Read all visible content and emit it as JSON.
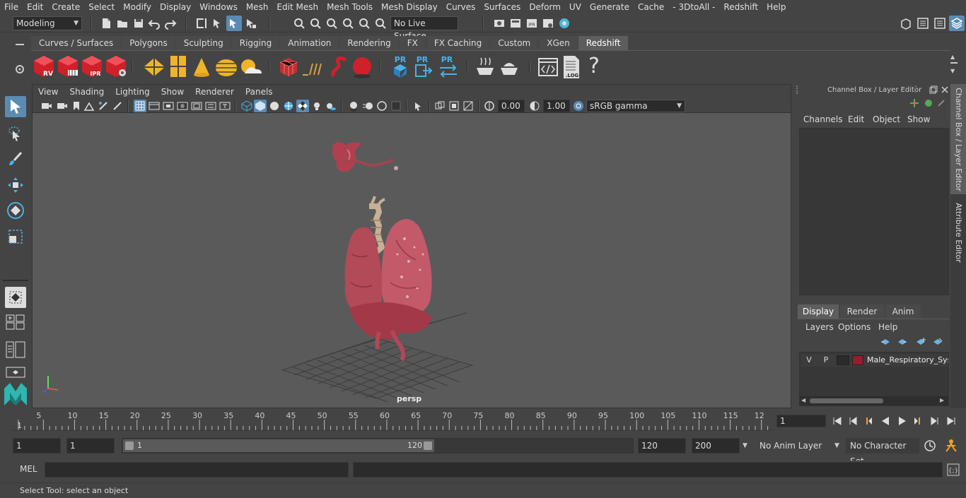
{
  "menubar": {
    "items": [
      "File",
      "Edit",
      "Create",
      "Select",
      "Modify",
      "Display",
      "Windows",
      "Mesh",
      "Edit Mesh",
      "Mesh Tools",
      "Mesh Display",
      "Curves",
      "Surfaces",
      "Deform",
      "UV",
      "Generate",
      "Cache",
      "- 3DtoAll -",
      "Redshift",
      "Help"
    ]
  },
  "statusline": {
    "mode": "Modeling",
    "live_surface": "No Live Surface"
  },
  "shelf": {
    "tabs": [
      "Curves / Surfaces",
      "Polygons",
      "Sculpting",
      "Rigging",
      "Animation",
      "Rendering",
      "FX",
      "FX Caching",
      "Custom",
      "XGen",
      "Redshift"
    ],
    "active_tab": "Redshift",
    "icon_labels": [
      "RV",
      "IPR",
      "PR",
      "PR",
      "PR",
      ".LOG",
      "?"
    ]
  },
  "viewport": {
    "menu": [
      "View",
      "Shading",
      "Lighting",
      "Show",
      "Renderer",
      "Panels"
    ],
    "exposure": "0.00",
    "gamma": "1.00",
    "color_space": "sRGB gamma",
    "camera_label": "persp"
  },
  "channelbox": {
    "title": "Channel Box / Layer Editor",
    "menu": [
      "Channels",
      "Edit",
      "Object",
      "Show"
    ],
    "layer_tabs": [
      "Display",
      "Render",
      "Anim"
    ],
    "active_layer_tab": "Display",
    "layer_menu": [
      "Layers",
      "Options",
      "Help"
    ],
    "layer": {
      "v": "V",
      "p": "P",
      "name": "Male_Respiratory_Syst",
      "color": "#9b1a2e"
    }
  },
  "side_tabs": [
    "Channel Box / Layer Editor",
    "Attribute Editor"
  ],
  "timeline": {
    "ticks": [
      "5",
      "10",
      "15",
      "20",
      "25",
      "30",
      "35",
      "40",
      "45",
      "50",
      "55",
      "60",
      "65",
      "70",
      "75",
      "80",
      "85",
      "90",
      "95",
      "100",
      "105",
      "110",
      "115",
      "12"
    ],
    "start_label": "1",
    "current_frame": "1"
  },
  "range": {
    "start": "1",
    "playback_start": "1",
    "slider_start": "1",
    "slider_end": "120",
    "playback_end": "120",
    "end": "200",
    "anim_layer": "No Anim Layer",
    "character_set": "No Character Set"
  },
  "cmdline": {
    "label": "MEL"
  },
  "helpline": {
    "text": "Select Tool: select an object"
  },
  "colors": {
    "accent": "#5a8bb3",
    "redshift_red": "#d0202a",
    "shelf_yellow": "#f0b429"
  }
}
